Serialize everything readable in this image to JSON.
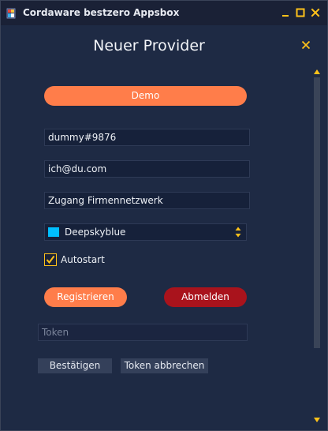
{
  "window": {
    "title": "Cordaware bestzero Appsbox"
  },
  "dialog": {
    "title": "Neuer Provider"
  },
  "form": {
    "demo_label": "Demo",
    "username_value": "dummy#9876",
    "email_value": "ich@du.com",
    "description_value": "Zugang Firmennetzwerk",
    "color": {
      "selected_label": "Deepskyblue",
      "selected_hex": "#00bfff"
    },
    "autostart": {
      "label": "Autostart",
      "checked": true
    },
    "register_label": "Registrieren",
    "logout_label": "Abmelden",
    "token_placeholder": "Token",
    "confirm_label": "Bestätigen",
    "abort_token_label": "Token abbrechen"
  },
  "colors": {
    "background": "#1e2a44",
    "titlebar": "#1a2136",
    "accent_orange": "#ff7d4a",
    "accent_yellow": "#ffc21a",
    "danger_red": "#a9131c"
  },
  "icons": {
    "app": "app-logo-icon",
    "minimize": "minimize-icon",
    "maximize": "maximize-icon",
    "close": "close-icon",
    "dialog_close": "close-x-icon",
    "check": "checkmark-icon",
    "spinner": "up-down-arrows-icon",
    "scroll_up": "caret-up-icon",
    "scroll_down": "caret-down-icon"
  }
}
